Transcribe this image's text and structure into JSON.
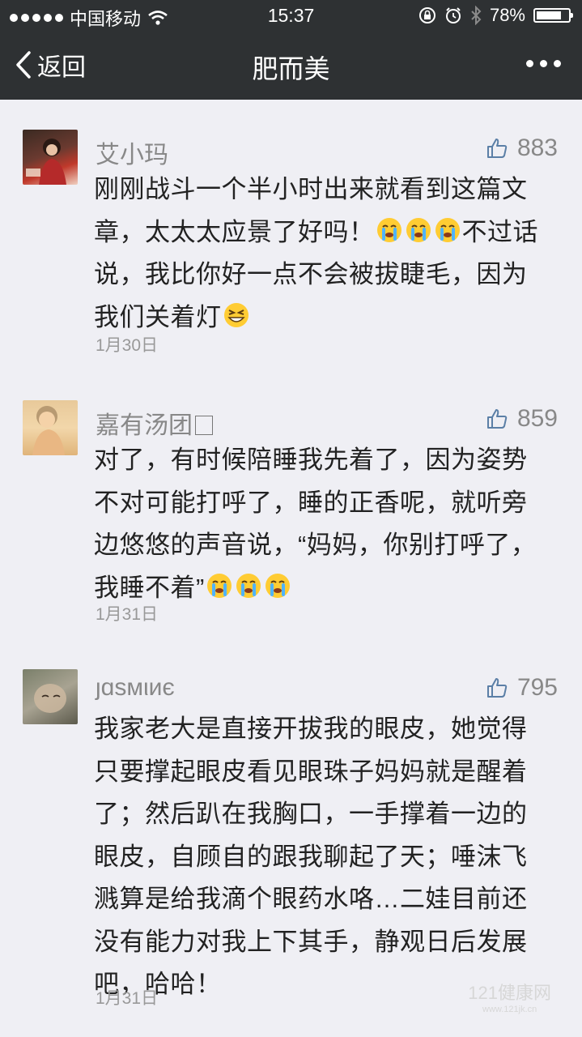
{
  "status_bar": {
    "carrier": "中国移动",
    "time": "15:37",
    "battery": "78%",
    "battery_level": 0.78
  },
  "nav": {
    "back_label": "返回",
    "title": "肥而美"
  },
  "comments": [
    {
      "name": "艾小玛",
      "likes": "883",
      "text_parts": [
        "刚刚战斗一个半小时出来就看到这篇文章，太太太应景了好吗！",
        "不过话说，我比你好一点不会被拔睫毛，因为我们关着灯"
      ],
      "emojis": [
        "crying-emoji",
        "crying-emoji",
        "crying-emoji",
        "grinning-emoji"
      ],
      "date": "1月30日"
    },
    {
      "name": "嘉有汤团",
      "likes": "859",
      "text_parts": [
        "对了，有时候陪睡我先着了，因为姿势不对可能打呼了，睡的正香呢，就听旁边悠悠的声音说，“妈妈，你别打呼了，我睡不着”"
      ],
      "emojis": [
        "crying-emoji",
        "crying-emoji",
        "crying-emoji"
      ],
      "date": "1月31日"
    },
    {
      "name": "ȷɑsмιиє",
      "likes": "795",
      "text_parts": [
        "我家老大是直接开拔我的眼皮，她觉得只要撑起眼皮看见眼珠子妈妈就是醒着了；然后趴在我胸口，一手撑着一边的眼皮，自顾自的跟我聊起了天；唾沫飞溅算是给我滴个眼药水咯…二娃目前还没有能力对我上下其手，静观日后发展吧，哈哈！"
      ],
      "emojis": [],
      "date": "1月31日"
    }
  ],
  "watermark": {
    "line1": "121健康网",
    "line2": "www.121jk.cn"
  }
}
